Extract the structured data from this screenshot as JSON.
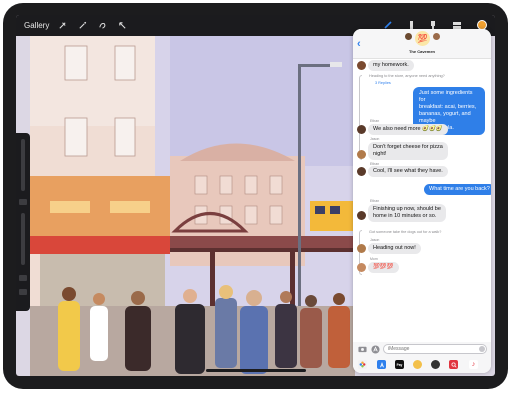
{
  "toolbar": {
    "gallery_label": "Gallery",
    "left_tools": [
      "wrench-icon",
      "magic-wand-icon",
      "selection-icon",
      "transform-arrow-icon"
    ],
    "right_tools": [
      "brush-icon",
      "smudge-icon",
      "eraser-icon",
      "layers-icon"
    ],
    "current_color": "#f0a030"
  },
  "messages": {
    "group_name": "The Cavemen",
    "group_avatar_emoji": "💯",
    "input_placeholder": "iMessage",
    "items": [
      {
        "type": "in",
        "text": "my homework."
      },
      {
        "type": "faint",
        "text": "Heading to the store, anyone need anything?"
      },
      {
        "type": "replies",
        "text": "3 Replies"
      },
      {
        "type": "out",
        "lines": [
          "Just some ingredients for",
          "breakfast: acai, berries,",
          "bananas, yogurt, and maybe",
          "some granola."
        ]
      },
      {
        "type": "sender",
        "text": "Ethan"
      },
      {
        "type": "in",
        "text": "We also need more 🥑🥑🥑"
      },
      {
        "type": "sender",
        "text": "Jason"
      },
      {
        "type": "in",
        "lines": [
          "Don't forget cheese for pizza",
          "night!"
        ]
      },
      {
        "type": "sender",
        "text": "Ethan"
      },
      {
        "type": "in",
        "text": "Cool, I'll see what they have."
      },
      {
        "type": "out",
        "text": "What time are you back?"
      },
      {
        "type": "sender",
        "text": "Ethan"
      },
      {
        "type": "in",
        "lines": [
          "Finishing up now, should be",
          "home in 10 minutes or so."
        ]
      },
      {
        "type": "faint",
        "text": "Got someone take the dogs out for a walk?"
      },
      {
        "type": "sender",
        "text": "Jason"
      },
      {
        "type": "in",
        "text": "Heading out now!"
      },
      {
        "type": "sender",
        "text": "Mom"
      },
      {
        "type": "in",
        "text": "💯💯💯"
      }
    ],
    "app_strip": [
      {
        "name": "photos-app-icon",
        "label": "",
        "color": "#f2f2f2"
      },
      {
        "name": "app-store-icon",
        "label": "",
        "color": "#2f80ed"
      },
      {
        "name": "apple-pay-icon",
        "label": "Pay",
        "color": "#111111"
      },
      {
        "name": "memoji-icon",
        "label": "",
        "color": "#f3c04a"
      },
      {
        "name": "memoji-2-icon",
        "label": "",
        "color": "#333333"
      },
      {
        "name": "search-images-icon",
        "label": "",
        "color": "#e0343f"
      },
      {
        "name": "music-icon",
        "label": "♪",
        "color": "#ffffff"
      }
    ]
  }
}
